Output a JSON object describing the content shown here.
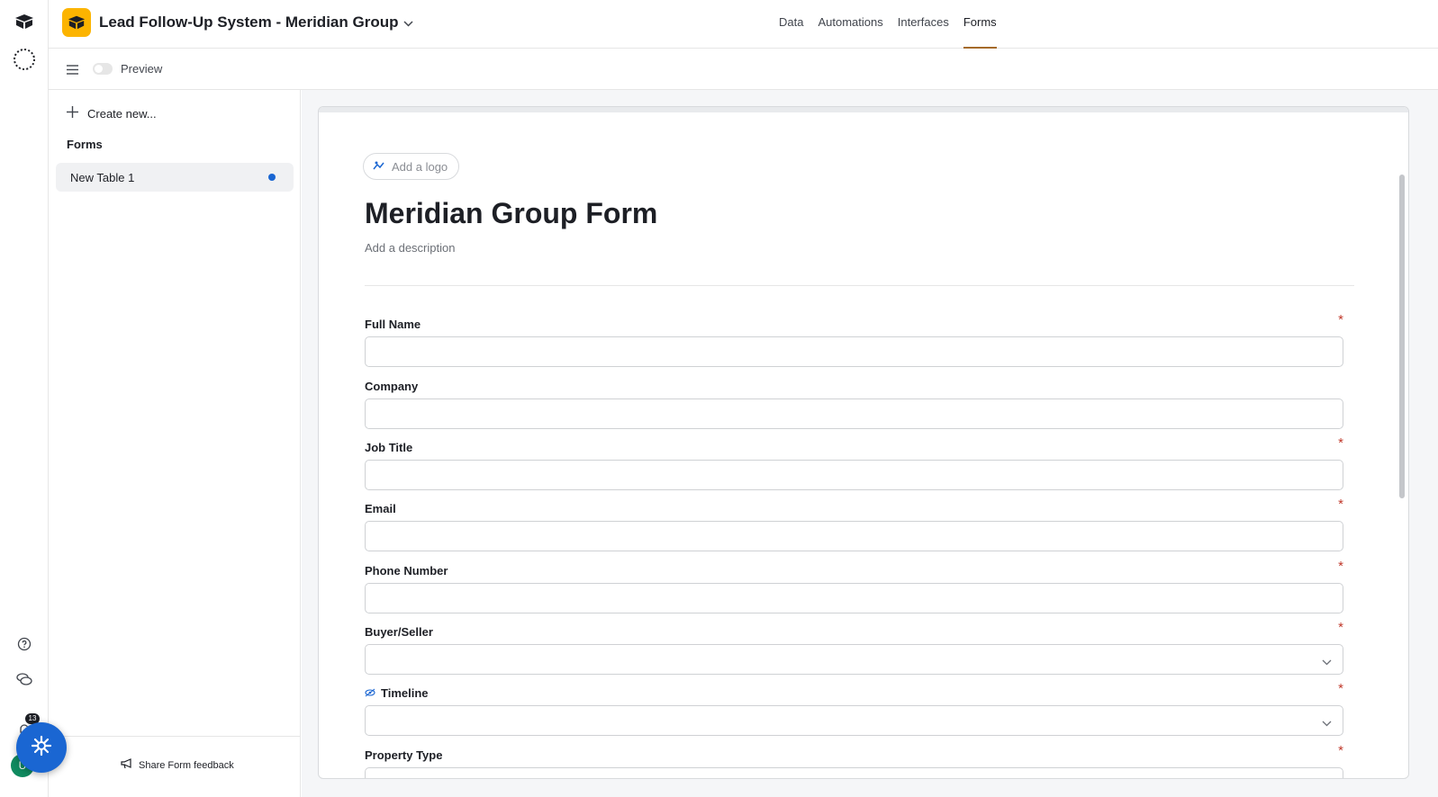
{
  "app": {
    "title": "Lead Follow-Up System - Meridian Group",
    "notification_count": "13",
    "avatar_initial": "U",
    "accent": "#fcb400"
  },
  "nav": {
    "tabs": [
      {
        "label": "Data"
      },
      {
        "label": "Automations"
      },
      {
        "label": "Interfaces"
      },
      {
        "label": "Forms"
      }
    ],
    "active_tab": "Forms"
  },
  "toolbar": {
    "preview_label": "Preview"
  },
  "sidebar": {
    "create_new_label": "Create new...",
    "forms_heading": "Forms",
    "items": [
      {
        "label": "New Table 1"
      }
    ],
    "feedback_label": "Share Form feedback"
  },
  "form": {
    "logo_button_label": "Add a logo",
    "title": "Meridian Group Form",
    "description_placeholder": "Add a description",
    "fields": [
      {
        "label": "Full Name",
        "required": "*"
      },
      {
        "label": "Company",
        "required": ""
      },
      {
        "label": "Job Title",
        "required": "*"
      },
      {
        "label": "Email",
        "required": "*"
      },
      {
        "label": "Phone Number",
        "required": "*"
      },
      {
        "label": "Buyer/Seller",
        "required": "*"
      },
      {
        "label": "Timeline",
        "required": "*"
      },
      {
        "label": "Property Type",
        "required": "*"
      }
    ]
  },
  "icons": {
    "app_logo": "airtable-logo-icon",
    "home": "home-logo-icon",
    "workspace": "dotted-circle-icon",
    "help": "help-circle-icon",
    "chat": "chat-bubbles-icon",
    "bell": "bell-icon",
    "menu": "hamburger-menu-icon",
    "plus": "plus-icon",
    "feedback": "megaphone-icon",
    "logo_upload": "image-sparkle-icon",
    "hidden": "eye-off-icon",
    "chevron": "chevron-down-icon",
    "assistant": "sparkle-snowflake-icon"
  }
}
